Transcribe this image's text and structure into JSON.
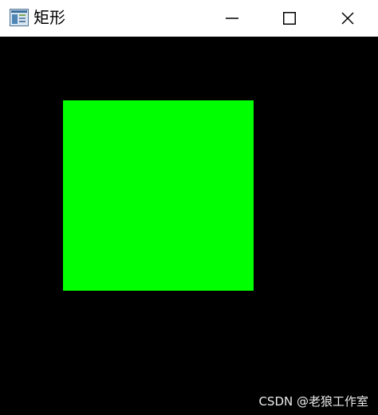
{
  "window": {
    "title": "矩形",
    "app_icon": "window-app-icon",
    "controls": {
      "minimize_icon": "minimize-icon",
      "maximize_icon": "maximize-icon",
      "close_icon": "close-icon"
    }
  },
  "canvas": {
    "background_color": "#000000",
    "rectangle_color": "#00ff00"
  },
  "watermark": "CSDN @老狼工作室"
}
